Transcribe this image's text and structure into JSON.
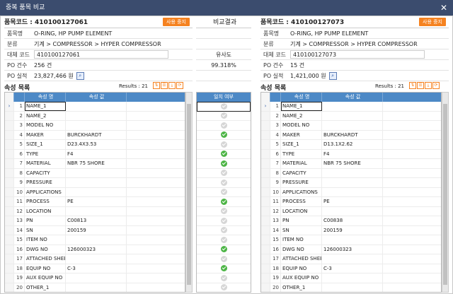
{
  "window": {
    "title": "중복 품목 비교"
  },
  "left": {
    "code_header": "품목코드 : 410100127061",
    "use_button": "사용 중지",
    "info": [
      {
        "label": "품목명",
        "value": "O-RING, HP PUMP ELEMENT"
      },
      {
        "label": "분류",
        "value": "기계 > COMPRESSOR > HYPER COMPRESSOR"
      },
      {
        "label": "대체 코드",
        "value": "410100127061"
      },
      {
        "label": "PO 건수",
        "value": "256 건"
      },
      {
        "label": "PO 실적",
        "value": "23,827,466 원"
      }
    ],
    "section_title": "속성 목록",
    "results": "Results : 21",
    "col_name": "속성 명",
    "col_value": "속성 값",
    "rows": [
      {
        "no": "1",
        "name": "NAME_1",
        "value": ""
      },
      {
        "no": "2",
        "name": "NAME_2",
        "value": ""
      },
      {
        "no": "3",
        "name": "MODEL NO",
        "value": ""
      },
      {
        "no": "4",
        "name": "MAKER",
        "value": "BURCKHARDT"
      },
      {
        "no": "5",
        "name": "SIZE_1",
        "value": "D23.4X3.53"
      },
      {
        "no": "6",
        "name": "TYPE",
        "value": "F4"
      },
      {
        "no": "7",
        "name": "MATERIAL",
        "value": "NBR 75 SHORE"
      },
      {
        "no": "8",
        "name": "CAPACITY",
        "value": ""
      },
      {
        "no": "9",
        "name": "PRESSURE",
        "value": ""
      },
      {
        "no": "10",
        "name": "APPLICATIONS",
        "value": ""
      },
      {
        "no": "11",
        "name": "PROCESS",
        "value": "PE"
      },
      {
        "no": "12",
        "name": "LOCATION",
        "value": ""
      },
      {
        "no": "13",
        "name": "PN",
        "value": "C00813"
      },
      {
        "no": "14",
        "name": "SN",
        "value": "200159"
      },
      {
        "no": "15",
        "name": "ITEM NO",
        "value": ""
      },
      {
        "no": "16",
        "name": "DWG NO",
        "value": "126000323"
      },
      {
        "no": "17",
        "name": "ATTACHED SHEET",
        "value": ""
      },
      {
        "no": "18",
        "name": "EQUIP NO",
        "value": "C-3"
      },
      {
        "no": "19",
        "name": "AUX EQUIP NO",
        "value": ""
      },
      {
        "no": "20",
        "name": "OTHER_1",
        "value": ""
      }
    ]
  },
  "middle": {
    "title": "비교결과",
    "similarity_label": "유사도",
    "similarity_value": "99.318%",
    "col_match": "일치 여부",
    "matches": [
      false,
      false,
      false,
      true,
      false,
      true,
      true,
      false,
      false,
      false,
      true,
      false,
      false,
      false,
      false,
      true,
      false,
      true,
      false,
      false
    ]
  },
  "right": {
    "code_header": "품목코드 : 410100127073",
    "use_button": "사용 중지",
    "info": [
      {
        "label": "품목명",
        "value": "O-RING, HP PUMP ELEMENT"
      },
      {
        "label": "분류",
        "value": "기계 > COMPRESSOR > HYPER COMPRESSOR"
      },
      {
        "label": "대체 코드",
        "value": "410100127073"
      },
      {
        "label": "PO 건수",
        "value": "15 건"
      },
      {
        "label": "PO 실적",
        "value": "1,421,000 원"
      }
    ],
    "section_title": "속성 목록",
    "results": "Results : 21",
    "col_name": "속성 명",
    "col_value": "속성 값",
    "rows": [
      {
        "no": "1",
        "name": "NAME_1",
        "value": ""
      },
      {
        "no": "2",
        "name": "NAME_2",
        "value": ""
      },
      {
        "no": "3",
        "name": "MODEL NO",
        "value": ""
      },
      {
        "no": "4",
        "name": "MAKER",
        "value": "BURCKHARDT"
      },
      {
        "no": "5",
        "name": "SIZE_1",
        "value": "D13.1X2.62"
      },
      {
        "no": "6",
        "name": "TYPE",
        "value": "F4"
      },
      {
        "no": "7",
        "name": "MATERIAL",
        "value": "NBR 75 SHORE"
      },
      {
        "no": "8",
        "name": "CAPACITY",
        "value": ""
      },
      {
        "no": "9",
        "name": "PRESSURE",
        "value": ""
      },
      {
        "no": "10",
        "name": "APPLICATIONS",
        "value": ""
      },
      {
        "no": "11",
        "name": "PROCESS",
        "value": "PE"
      },
      {
        "no": "12",
        "name": "LOCATION",
        "value": ""
      },
      {
        "no": "13",
        "name": "PN",
        "value": "C00838"
      },
      {
        "no": "14",
        "name": "SN",
        "value": "200159"
      },
      {
        "no": "15",
        "name": "ITEM NO",
        "value": ""
      },
      {
        "no": "16",
        "name": "DWG NO",
        "value": "126000323"
      },
      {
        "no": "17",
        "name": "ATTACHED SHEET",
        "value": ""
      },
      {
        "no": "18",
        "name": "EQUIP NO",
        "value": "C-3"
      },
      {
        "no": "19",
        "name": "AUX EQUIP NO",
        "value": ""
      },
      {
        "no": "20",
        "name": "OTHER_1",
        "value": ""
      }
    ]
  },
  "colors": {
    "accent": "#f58220",
    "header_blue": "#4d89c6",
    "match_green": "#4db546",
    "titlebar": "#3b4c6e"
  }
}
